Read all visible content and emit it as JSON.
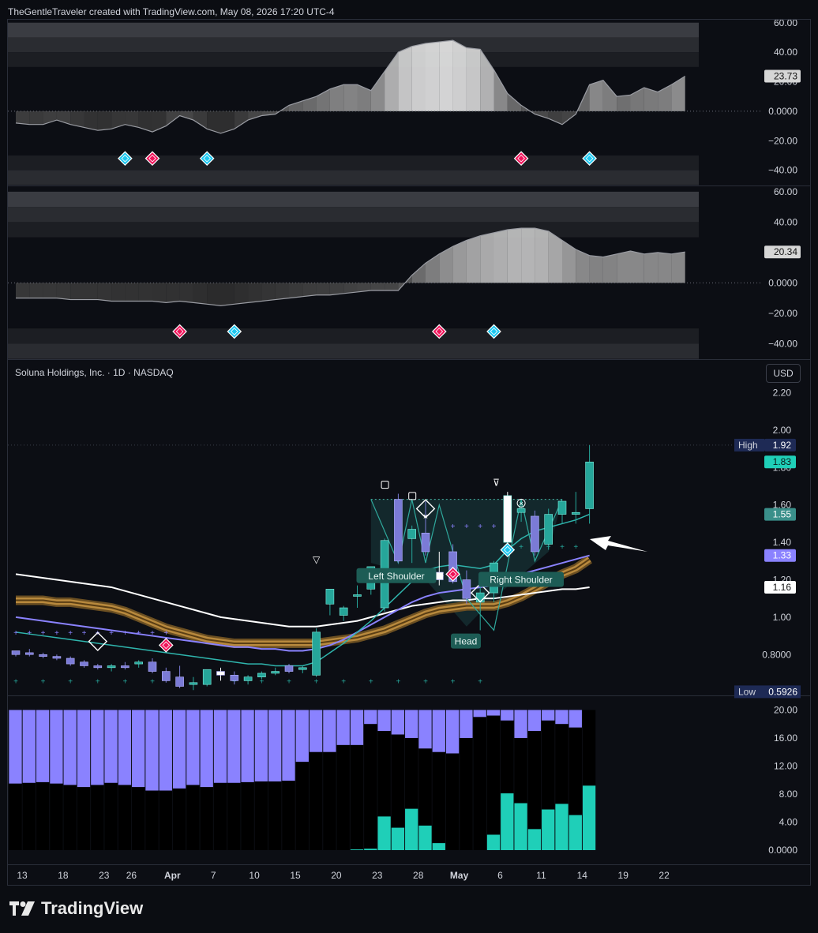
{
  "header": "TheGentleTraveler created with TradingView.com, May 08, 2026 17:20 UTC-4",
  "symbol": "Soluna Holdings, Inc. · 1D · NASDAQ",
  "currency": "USD",
  "footer": "TradingView",
  "colors": {
    "bull": "#26a69a",
    "bear": "#7b7bd6",
    "teal": "#1fcfb8",
    "purple": "#8a82ff",
    "gold": "#b8893d",
    "pink": "#f0145a",
    "cyan": "#1ec8f0"
  },
  "x_labels": [
    "13",
    "18",
    "23",
    "26",
    "Apr",
    "7",
    "10",
    "15",
    "20",
    "23",
    "28",
    "May",
    "6",
    "11",
    "14",
    "19",
    "22"
  ],
  "pane1": {
    "ticks": [
      "60.00",
      "40.00",
      "20.00",
      "0.0000",
      "−20.00",
      "−40.00"
    ],
    "last_value": "23.73"
  },
  "pane2": {
    "ticks": [
      "60.00",
      "40.00",
      "20.00",
      "0.0000",
      "−20.00",
      "−40.00"
    ],
    "last_value": "20.34"
  },
  "price": {
    "ticks": [
      "2.20",
      "2.00",
      "1.80",
      "1.60",
      "1.40",
      "1.20",
      "1.00",
      "0.8000"
    ],
    "high_label": "High",
    "high_value": "1.92",
    "low_label": "Low",
    "low_value": "0.5926",
    "last_price": "1.83",
    "ma_fast_value": "1.55",
    "ma_mid_value": "1.33",
    "ma_slow_value": "1.16",
    "annotations": [
      "Left Shoulder",
      "Head",
      "Right Shoulder"
    ]
  },
  "volume": {
    "ticks": [
      "20.00",
      "16.00",
      "12.00",
      "8.00",
      "4.00",
      "0.0000"
    ]
  },
  "chart_data": [
    {
      "type": "area",
      "title": "",
      "ylim": [
        -45,
        62
      ],
      "values": [
        -8,
        -9,
        -9,
        -6,
        -9,
        -11,
        -13,
        -12,
        -9,
        -11,
        -14,
        -10,
        -3,
        -6,
        -12,
        -15,
        -12,
        -6,
        -3,
        -2,
        4,
        7,
        10,
        15,
        18,
        18,
        14,
        27,
        40,
        44,
        46,
        47,
        48,
        43,
        42,
        28,
        12,
        4,
        -2,
        -5,
        -9,
        -2,
        18,
        21,
        10,
        11,
        16,
        13,
        18,
        23.73
      ],
      "signals_pink": [
        10,
        37
      ],
      "signals_cyan": [
        8,
        14,
        42
      ]
    },
    {
      "type": "area",
      "title": "",
      "ylim": [
        -45,
        62
      ],
      "values": [
        -10,
        -10,
        -10,
        -10,
        -11,
        -11,
        -11,
        -12,
        -12,
        -12,
        -12,
        -13,
        -12,
        -13,
        -14,
        -15,
        -14,
        -13,
        -12,
        -11,
        -10,
        -9,
        -8,
        -8,
        -7,
        -6,
        -5,
        -5,
        -5,
        5,
        13,
        19,
        24,
        28,
        31,
        33,
        35,
        36,
        36,
        34,
        28,
        22,
        18,
        17,
        19,
        21,
        19,
        20,
        19,
        20.34
      ],
      "signals_pink": [
        12,
        31
      ],
      "signals_cyan": [
        16,
        35
      ]
    },
    {
      "type": "candlestick",
      "title": "Soluna Holdings, Inc. · 1D · NASDAQ",
      "ylim": [
        0.59,
        2.27
      ],
      "candles": [
        [
          0.82,
          0.82,
          0.79,
          0.8
        ],
        [
          0.81,
          0.83,
          0.79,
          0.8
        ],
        [
          0.8,
          0.81,
          0.78,
          0.79
        ],
        [
          0.79,
          0.8,
          0.77,
          0.78
        ],
        [
          0.78,
          0.79,
          0.74,
          0.75
        ],
        [
          0.76,
          0.77,
          0.73,
          0.74
        ],
        [
          0.74,
          0.75,
          0.72,
          0.73
        ],
        [
          0.73,
          0.75,
          0.71,
          0.74
        ],
        [
          0.74,
          0.76,
          0.72,
          0.73
        ],
        [
          0.75,
          0.77,
          0.73,
          0.76
        ],
        [
          0.76,
          0.78,
          0.7,
          0.71
        ],
        [
          0.71,
          0.73,
          0.65,
          0.66
        ],
        [
          0.68,
          0.74,
          0.62,
          0.63
        ],
        [
          0.64,
          0.68,
          0.61,
          0.65
        ],
        [
          0.64,
          0.72,
          0.63,
          0.72
        ],
        [
          0.71,
          0.73,
          0.66,
          0.69
        ],
        [
          0.69,
          0.71,
          0.64,
          0.66
        ],
        [
          0.66,
          0.69,
          0.64,
          0.68
        ],
        [
          0.68,
          0.71,
          0.67,
          0.7
        ],
        [
          0.7,
          0.73,
          0.69,
          0.71
        ],
        [
          0.74,
          0.75,
          0.7,
          0.71
        ],
        [
          0.72,
          0.74,
          0.7,
          0.73
        ],
        [
          0.69,
          0.94,
          0.68,
          0.92
        ],
        [
          1.07,
          1.15,
          1.01,
          1.15
        ],
        [
          1.01,
          1.06,
          0.98,
          1.05
        ],
        [
          1.12,
          1.17,
          1.05,
          1.12
        ],
        [
          1.15,
          1.27,
          1.12,
          1.27
        ],
        [
          1.05,
          1.42,
          1.03,
          1.41
        ],
        [
          1.63,
          1.66,
          1.29,
          1.3
        ],
        [
          1.42,
          1.49,
          1.29,
          1.47
        ],
        [
          1.45,
          1.62,
          1.33,
          1.35
        ],
        [
          1.24,
          1.35,
          1.17,
          1.2
        ],
        [
          1.35,
          1.39,
          1.18,
          1.19
        ],
        [
          1.2,
          1.25,
          1.07,
          1.1
        ],
        [
          1.08,
          1.17,
          0.93,
          1.13
        ],
        [
          1.13,
          1.3,
          1.08,
          1.29
        ],
        [
          1.4,
          1.67,
          1.39,
          1.65
        ],
        [
          1.56,
          1.62,
          1.51,
          1.58
        ],
        [
          1.54,
          1.57,
          1.33,
          1.35
        ],
        [
          1.39,
          1.58,
          1.36,
          1.55
        ],
        [
          1.55,
          1.62,
          1.5,
          1.62
        ],
        [
          1.55,
          1.67,
          1.5,
          1.56
        ],
        [
          1.58,
          1.92,
          1.5,
          1.83
        ]
      ],
      "ma_fast": [
        0.92,
        0.91,
        0.9,
        0.89,
        0.88,
        0.87,
        0.86,
        0.85,
        0.84,
        0.83,
        0.82,
        0.81,
        0.8,
        0.79,
        0.78,
        0.77,
        0.76,
        0.75,
        0.75,
        0.74,
        0.74,
        0.74,
        0.76,
        0.81,
        0.86,
        0.92,
        0.98,
        1.05,
        1.12,
        1.19,
        1.25,
        1.27,
        1.28,
        1.27,
        1.26,
        1.28,
        1.36,
        1.42,
        1.46,
        1.48,
        1.5,
        1.52,
        1.55
      ],
      "ma_mid": [
        1.0,
        0.99,
        0.98,
        0.97,
        0.96,
        0.95,
        0.94,
        0.93,
        0.92,
        0.91,
        0.9,
        0.89,
        0.88,
        0.87,
        0.86,
        0.85,
        0.84,
        0.84,
        0.83,
        0.83,
        0.82,
        0.82,
        0.83,
        0.85,
        0.88,
        0.92,
        0.96,
        1.0,
        1.04,
        1.08,
        1.11,
        1.13,
        1.14,
        1.15,
        1.16,
        1.17,
        1.2,
        1.23,
        1.25,
        1.27,
        1.29,
        1.31,
        1.33
      ],
      "ma_slow": [
        1.23,
        1.22,
        1.21,
        1.2,
        1.19,
        1.18,
        1.17,
        1.16,
        1.14,
        1.12,
        1.1,
        1.08,
        1.06,
        1.04,
        1.02,
        1.0,
        0.99,
        0.98,
        0.97,
        0.96,
        0.95,
        0.95,
        0.95,
        0.96,
        0.97,
        0.98,
        1.0,
        1.02,
        1.04,
        1.06,
        1.07,
        1.08,
        1.09,
        1.09,
        1.1,
        1.1,
        1.11,
        1.12,
        1.13,
        1.14,
        1.15,
        1.15,
        1.16
      ],
      "ribbon": [
        1.09,
        1.09,
        1.09,
        1.08,
        1.08,
        1.07,
        1.06,
        1.05,
        1.03,
        1.0,
        0.97,
        0.94,
        0.92,
        0.9,
        0.88,
        0.87,
        0.86,
        0.86,
        0.86,
        0.86,
        0.86,
        0.86,
        0.86,
        0.87,
        0.88,
        0.89,
        0.91,
        0.93,
        0.96,
        0.99,
        1.02,
        1.04,
        1.05,
        1.06,
        1.06,
        1.06,
        1.08,
        1.11,
        1.15,
        1.19,
        1.23,
        1.26,
        1.31
      ]
    },
    {
      "type": "bar",
      "title": "",
      "ylim": [
        0,
        20.5
      ],
      "background": [
        20,
        20,
        20,
        20,
        20,
        20,
        20,
        20,
        20,
        20,
        20,
        20,
        20,
        20,
        20,
        20,
        20,
        20,
        20,
        20,
        20,
        20,
        20,
        20,
        20,
        20,
        20,
        20,
        20,
        20,
        20,
        20,
        20,
        20,
        20,
        20,
        20,
        20,
        20,
        20,
        20,
        20,
        20
      ],
      "purple_top_from": [
        9.5,
        9.6,
        9.7,
        9.5,
        9.3,
        9.0,
        9.3,
        9.6,
        9.3,
        9.0,
        8.5,
        8.5,
        8.8,
        9.3,
        9.0,
        9.6,
        9.6,
        9.7,
        9.8,
        9.8,
        9.9,
        12.6,
        14.0,
        14.0,
        15.0,
        15.0,
        18.0,
        17.0,
        16.5,
        16.0,
        14.5,
        14.0,
        13.8,
        16.0,
        19.0,
        19.2,
        18.5,
        16.0,
        17.0,
        18.5,
        18.0,
        17.5,
        20.0
      ],
      "teal": [
        0,
        0,
        0,
        0,
        0,
        0,
        0,
        0,
        0,
        0,
        0,
        0,
        0,
        0,
        0,
        0,
        0,
        0,
        0,
        0,
        0,
        0,
        0,
        0,
        0,
        0.1,
        0.2,
        4.8,
        3.2,
        5.9,
        3.5,
        1.0,
        0,
        0,
        0,
        2.2,
        8.1,
        6.7,
        3.0,
        5.8,
        6.6,
        5.0,
        9.2
      ]
    }
  ]
}
